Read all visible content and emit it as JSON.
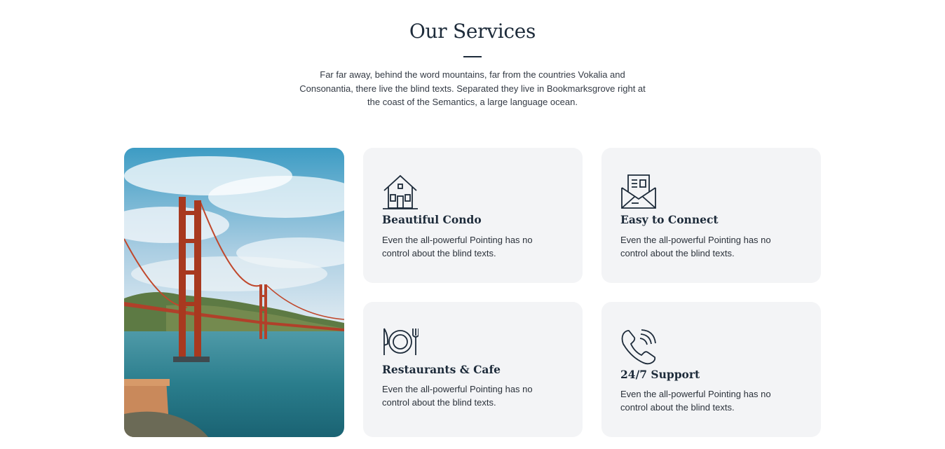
{
  "section": {
    "title": "Our Services",
    "lead": "Far far away, behind the word mountains, far from the countries Vokalia and Consonantia, there live the blind texts. Separated they live in Bookmarksgrove right at the coast of the Semantics, a large language ocean."
  },
  "colors": {
    "heading": "#1d2b3a",
    "card_bg": "#f3f4f6",
    "text": "#2b323b"
  },
  "services": [
    {
      "icon": "house-icon",
      "title": "Beautiful Condo",
      "text": "Even the all-powerful Pointing has no control about the blind texts."
    },
    {
      "icon": "envelope-icon",
      "title": "Easy to Connect",
      "text": "Even the all-powerful Pointing has no control about the blind texts."
    },
    {
      "icon": "plate-cutlery-icon",
      "title": "Restaurants & Cafe",
      "text": "Even the all-powerful Pointing has no control about the blind texts."
    },
    {
      "icon": "phone-icon",
      "title": "24/7 Support",
      "text": "Even the all-powerful Pointing has no control about the blind texts."
    }
  ]
}
